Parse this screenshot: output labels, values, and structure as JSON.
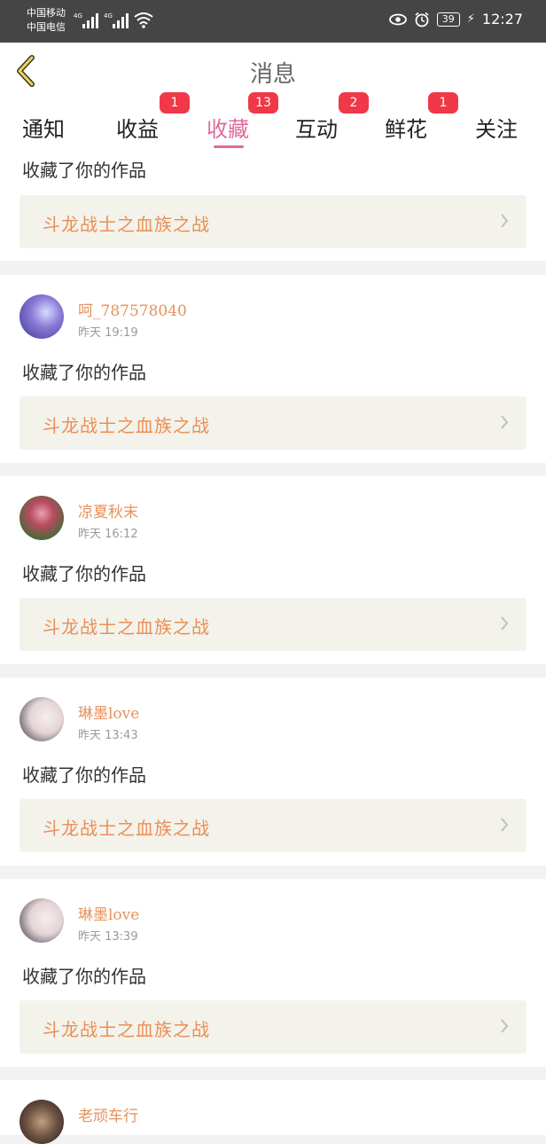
{
  "status_bar": {
    "carrier1": "中国移动",
    "carrier2": "中国电信",
    "net1": "4G",
    "net2": "4G",
    "battery": "39",
    "time": "12:27"
  },
  "header": {
    "title": "消息"
  },
  "tabs": [
    {
      "label": "通知",
      "badge": ""
    },
    {
      "label": "收益",
      "badge": "1"
    },
    {
      "label": "收藏",
      "badge": "13",
      "active": true
    },
    {
      "label": "互动",
      "badge": "2"
    },
    {
      "label": "鲜花",
      "badge": "1"
    },
    {
      "label": "关注",
      "badge": ""
    }
  ],
  "colors": {
    "accent": "#e06a9c",
    "username": "#e8915a",
    "work_title": "#ec8e54",
    "badge": "#f03848"
  },
  "messages": [
    {
      "action": "收藏了你的作品",
      "work_title": "斗龙战士之血族之战"
    },
    {
      "user": "呵_787578040",
      "time": "昨天 19:19",
      "action": "收藏了你的作品",
      "work_title": "斗龙战士之血族之战"
    },
    {
      "user": "凉夏秋末",
      "time": "昨天 16:12",
      "action": "收藏了你的作品",
      "work_title": "斗龙战士之血族之战"
    },
    {
      "user": "琳墨love",
      "time": "昨天 13:43",
      "action": "收藏了你的作品",
      "work_title": "斗龙战士之血族之战"
    },
    {
      "user": "琳墨love",
      "time": "昨天 13:39",
      "action": "收藏了你的作品",
      "work_title": "斗龙战士之血族之战"
    },
    {
      "user": "老顽车行"
    }
  ]
}
